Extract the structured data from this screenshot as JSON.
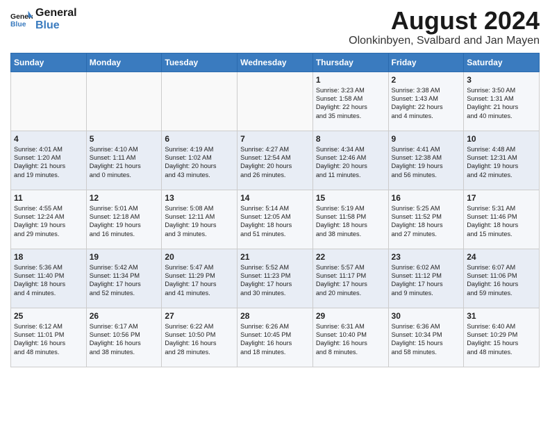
{
  "header": {
    "logo_line1": "General",
    "logo_line2": "Blue",
    "month_year": "August 2024",
    "location": "Olonkinbyen, Svalbard and Jan Mayen"
  },
  "days_of_week": [
    "Sunday",
    "Monday",
    "Tuesday",
    "Wednesday",
    "Thursday",
    "Friday",
    "Saturday"
  ],
  "weeks": [
    [
      {
        "day": "",
        "content": ""
      },
      {
        "day": "",
        "content": ""
      },
      {
        "day": "",
        "content": ""
      },
      {
        "day": "",
        "content": ""
      },
      {
        "day": "1",
        "content": "Sunrise: 3:23 AM\nSunset: 1:58 AM\nDaylight: 22 hours\nand 35 minutes."
      },
      {
        "day": "2",
        "content": "Sunrise: 3:38 AM\nSunset: 1:43 AM\nDaylight: 22 hours\nand 4 minutes."
      },
      {
        "day": "3",
        "content": "Sunrise: 3:50 AM\nSunset: 1:31 AM\nDaylight: 21 hours\nand 40 minutes."
      }
    ],
    [
      {
        "day": "4",
        "content": "Sunrise: 4:01 AM\nSunset: 1:20 AM\nDaylight: 21 hours\nand 19 minutes."
      },
      {
        "day": "5",
        "content": "Sunrise: 4:10 AM\nSunset: 1:11 AM\nDaylight: 21 hours\nand 0 minutes."
      },
      {
        "day": "6",
        "content": "Sunrise: 4:19 AM\nSunset: 1:02 AM\nDaylight: 20 hours\nand 43 minutes."
      },
      {
        "day": "7",
        "content": "Sunrise: 4:27 AM\nSunset: 12:54 AM\nDaylight: 20 hours\nand 26 minutes."
      },
      {
        "day": "8",
        "content": "Sunrise: 4:34 AM\nSunset: 12:46 AM\nDaylight: 20 hours\nand 11 minutes."
      },
      {
        "day": "9",
        "content": "Sunrise: 4:41 AM\nSunset: 12:38 AM\nDaylight: 19 hours\nand 56 minutes."
      },
      {
        "day": "10",
        "content": "Sunrise: 4:48 AM\nSunset: 12:31 AM\nDaylight: 19 hours\nand 42 minutes."
      }
    ],
    [
      {
        "day": "11",
        "content": "Sunrise: 4:55 AM\nSunset: 12:24 AM\nDaylight: 19 hours\nand 29 minutes."
      },
      {
        "day": "12",
        "content": "Sunrise: 5:01 AM\nSunset: 12:18 AM\nDaylight: 19 hours\nand 16 minutes."
      },
      {
        "day": "13",
        "content": "Sunrise: 5:08 AM\nSunset: 12:11 AM\nDaylight: 19 hours\nand 3 minutes."
      },
      {
        "day": "14",
        "content": "Sunrise: 5:14 AM\nSunset: 12:05 AM\nDaylight: 18 hours\nand 51 minutes."
      },
      {
        "day": "15",
        "content": "Sunrise: 5:19 AM\nSunset: 11:58 PM\nDaylight: 18 hours\nand 38 minutes."
      },
      {
        "day": "16",
        "content": "Sunrise: 5:25 AM\nSunset: 11:52 PM\nDaylight: 18 hours\nand 27 minutes."
      },
      {
        "day": "17",
        "content": "Sunrise: 5:31 AM\nSunset: 11:46 PM\nDaylight: 18 hours\nand 15 minutes."
      }
    ],
    [
      {
        "day": "18",
        "content": "Sunrise: 5:36 AM\nSunset: 11:40 PM\nDaylight: 18 hours\nand 4 minutes."
      },
      {
        "day": "19",
        "content": "Sunrise: 5:42 AM\nSunset: 11:34 PM\nDaylight: 17 hours\nand 52 minutes."
      },
      {
        "day": "20",
        "content": "Sunrise: 5:47 AM\nSunset: 11:29 PM\nDaylight: 17 hours\nand 41 minutes."
      },
      {
        "day": "21",
        "content": "Sunrise: 5:52 AM\nSunset: 11:23 PM\nDaylight: 17 hours\nand 30 minutes."
      },
      {
        "day": "22",
        "content": "Sunrise: 5:57 AM\nSunset: 11:17 PM\nDaylight: 17 hours\nand 20 minutes."
      },
      {
        "day": "23",
        "content": "Sunrise: 6:02 AM\nSunset: 11:12 PM\nDaylight: 17 hours\nand 9 minutes."
      },
      {
        "day": "24",
        "content": "Sunrise: 6:07 AM\nSunset: 11:06 PM\nDaylight: 16 hours\nand 59 minutes."
      }
    ],
    [
      {
        "day": "25",
        "content": "Sunrise: 6:12 AM\nSunset: 11:01 PM\nDaylight: 16 hours\nand 48 minutes."
      },
      {
        "day": "26",
        "content": "Sunrise: 6:17 AM\nSunset: 10:56 PM\nDaylight: 16 hours\nand 38 minutes."
      },
      {
        "day": "27",
        "content": "Sunrise: 6:22 AM\nSunset: 10:50 PM\nDaylight: 16 hours\nand 28 minutes."
      },
      {
        "day": "28",
        "content": "Sunrise: 6:26 AM\nSunset: 10:45 PM\nDaylight: 16 hours\nand 18 minutes."
      },
      {
        "day": "29",
        "content": "Sunrise: 6:31 AM\nSunset: 10:40 PM\nDaylight: 16 hours\nand 8 minutes."
      },
      {
        "day": "30",
        "content": "Sunrise: 6:36 AM\nSunset: 10:34 PM\nDaylight: 15 hours\nand 58 minutes."
      },
      {
        "day": "31",
        "content": "Sunrise: 6:40 AM\nSunset: 10:29 PM\nDaylight: 15 hours\nand 48 minutes."
      }
    ]
  ]
}
